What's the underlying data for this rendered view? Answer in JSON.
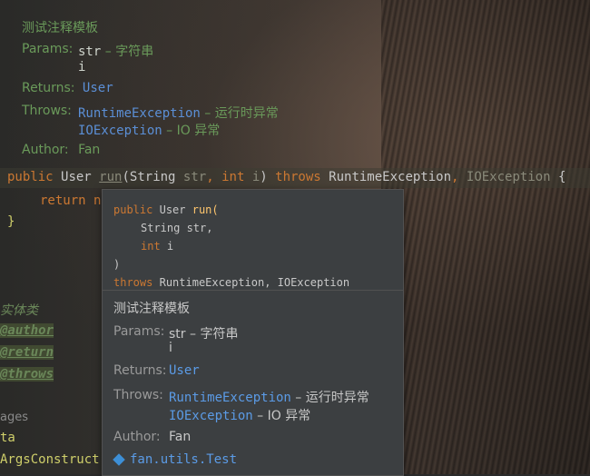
{
  "doc_top": {
    "title": "测试注释模板",
    "params_label": "Params:",
    "param1_name": "str",
    "param1_sep": " – ",
    "param1_desc": "字符串",
    "param2_name": "i",
    "returns_label": "Returns:",
    "returns_value": "User",
    "throws_label": "Throws:",
    "throw1_name": "RuntimeException",
    "throw1_sep": " – ",
    "throw1_desc": "运行时异常",
    "throw2_name": "IOException",
    "throw2_sep": " – ",
    "throw2_desc": "IO 异常",
    "author_label": "Author:",
    "author_value": "Fan"
  },
  "code": {
    "kw_public": "public",
    "type_user": "User",
    "method_run": "run",
    "open_paren": "(",
    "type_string": "String",
    "param_str": "str",
    "comma": ",",
    "kw_int": "int",
    "param_i": "i",
    "close_paren": ")",
    "kw_throws": "throws",
    "exc1": "RuntimeException",
    "exc2": "IOException",
    "brace_open": "{",
    "return_stmt": "return n",
    "brace_close": "}"
  },
  "left_javadoc": {
    "entity": "实体类",
    "tag_author": "@author",
    "tag_return": "@return",
    "tag_throws": "@throws",
    "ages": "ages",
    "ta": "ta",
    "args_constructor": "ArgsConstruct"
  },
  "popup": {
    "sig_line1_kw": "public",
    "sig_line1_type": "User",
    "sig_line1_fn": "run(",
    "sig_line2": "String str,",
    "sig_line3_kw": "int",
    "sig_line3_name": "i",
    "sig_line4": ")",
    "sig_line5_kw": "throws",
    "sig_line5_rest": "RuntimeException, IOException",
    "title": "测试注释模板",
    "params_label": "Params:",
    "param1": "str – 字符串",
    "param2": "i",
    "returns_label": "Returns:",
    "returns_value": "User",
    "throws_label": "Throws:",
    "throw1_name": "RuntimeException",
    "throw1_desc": " – 运行时异常",
    "throw2_name": "IOException",
    "throw2_desc": " – IO 异常",
    "author_label": "Author:",
    "author_value": "Fan",
    "package": "fan.utils.Test"
  }
}
